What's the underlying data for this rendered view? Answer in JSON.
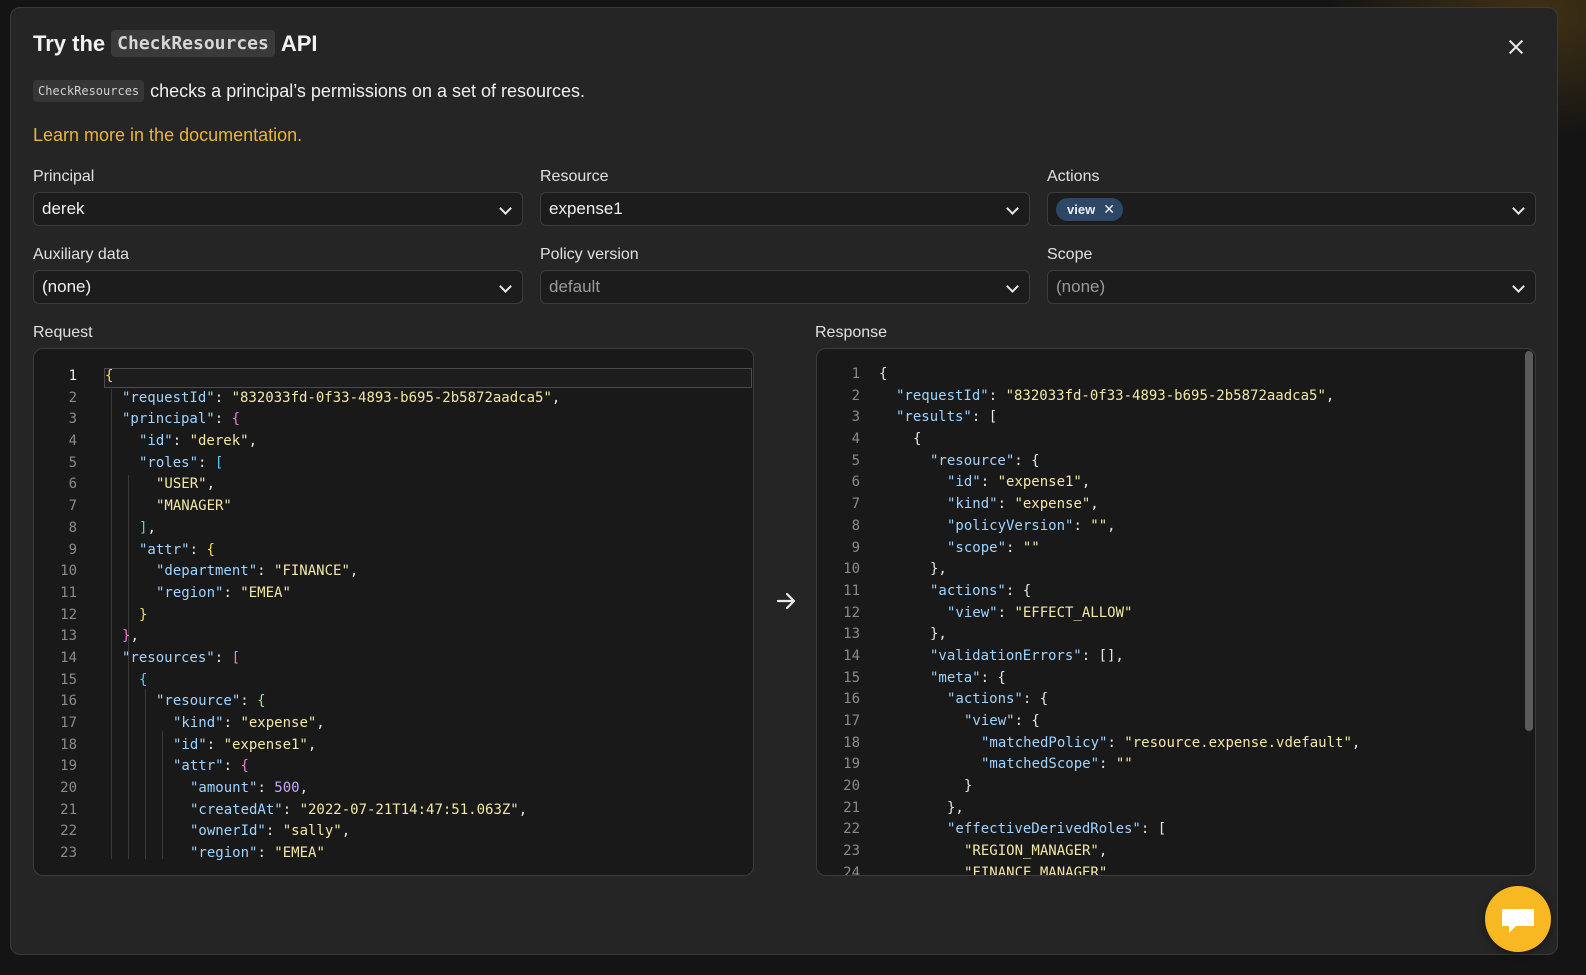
{
  "modal": {
    "title_prefix": "Try the",
    "title_code": "CheckResources",
    "title_suffix": "API",
    "desc_code": "CheckResources",
    "desc_text": "checks a principal’s permissions on a set of resources.",
    "doc_link": "Learn more in the documentation."
  },
  "fields": {
    "principal": {
      "label": "Principal",
      "value": "derek"
    },
    "resource": {
      "label": "Resource",
      "value": "expense1"
    },
    "actions": {
      "label": "Actions",
      "chips": [
        "view"
      ]
    },
    "auxiliary": {
      "label": "Auxiliary data",
      "value": "(none)"
    },
    "policy_version": {
      "label": "Policy version",
      "value": "default"
    },
    "scope": {
      "label": "Scope",
      "value": "(none)"
    }
  },
  "request": {
    "label": "Request",
    "lines": [
      [
        [
          "b1",
          "{"
        ]
      ],
      [
        [
          "k",
          "\"requestId\""
        ],
        [
          "p",
          ": "
        ],
        [
          "s",
          "\"832033fd-0f33-4893-b695-2b5872aadca5\""
        ],
        [
          "p",
          ","
        ]
      ],
      [
        [
          "k",
          "\"principal\""
        ],
        [
          "p",
          ": "
        ],
        [
          "b2",
          "{"
        ]
      ],
      [
        [
          "k",
          "\"id\""
        ],
        [
          "p",
          ": "
        ],
        [
          "s",
          "\"derek\""
        ],
        [
          "p",
          ","
        ]
      ],
      [
        [
          "k",
          "\"roles\""
        ],
        [
          "p",
          ": "
        ],
        [
          "b3",
          "["
        ]
      ],
      [
        [
          "s",
          "\"USER\""
        ],
        [
          "p",
          ","
        ]
      ],
      [
        [
          "s",
          "\"MANAGER\""
        ]
      ],
      [
        [
          "b3",
          "]"
        ],
        [
          "p",
          ","
        ]
      ],
      [
        [
          "k",
          "\"attr\""
        ],
        [
          "p",
          ": "
        ],
        [
          "b1",
          "{"
        ]
      ],
      [
        [
          "k",
          "\"department\""
        ],
        [
          "p",
          ": "
        ],
        [
          "s",
          "\"FINANCE\""
        ],
        [
          "p",
          ","
        ]
      ],
      [
        [
          "k",
          "\"region\""
        ],
        [
          "p",
          ": "
        ],
        [
          "s",
          "\"EMEA\""
        ]
      ],
      [
        [
          "b1",
          "}"
        ]
      ],
      [
        [
          "b2",
          "}"
        ],
        [
          "p",
          ","
        ]
      ],
      [
        [
          "k",
          "\"resources\""
        ],
        [
          "p",
          ": "
        ],
        [
          "b2",
          "["
        ]
      ],
      [
        [
          "b3",
          "{"
        ]
      ],
      [
        [
          "k",
          "\"resource\""
        ],
        [
          "p",
          ": "
        ],
        [
          "b4",
          "{"
        ]
      ],
      [
        [
          "k",
          "\"kind\""
        ],
        [
          "p",
          ": "
        ],
        [
          "s",
          "\"expense\""
        ],
        [
          "p",
          ","
        ]
      ],
      [
        [
          "k",
          "\"id\""
        ],
        [
          "p",
          ": "
        ],
        [
          "s",
          "\"expense1\""
        ],
        [
          "p",
          ","
        ]
      ],
      [
        [
          "k",
          "\"attr\""
        ],
        [
          "p",
          ": "
        ],
        [
          "b2",
          "{"
        ]
      ],
      [
        [
          "k",
          "\"amount\""
        ],
        [
          "p",
          ": "
        ],
        [
          "n",
          "500"
        ],
        [
          "p",
          ","
        ]
      ],
      [
        [
          "k",
          "\"createdAt\""
        ],
        [
          "p",
          ": "
        ],
        [
          "s",
          "\"2022-07-21T14:47:51.063Z\""
        ],
        [
          "p",
          ","
        ]
      ],
      [
        [
          "k",
          "\"ownerId\""
        ],
        [
          "p",
          ": "
        ],
        [
          "s",
          "\"sally\""
        ],
        [
          "p",
          ","
        ]
      ],
      [
        [
          "k",
          "\"region\""
        ],
        [
          "p",
          ": "
        ],
        [
          "s",
          "\"EMEA\""
        ]
      ]
    ]
  },
  "response": {
    "label": "Response",
    "lines": [
      [
        [
          "p",
          "{"
        ]
      ],
      [
        [
          "k",
          "\"requestId\""
        ],
        [
          "p",
          ": "
        ],
        [
          "s",
          "\"832033fd-0f33-4893-b695-2b5872aadca5\""
        ],
        [
          "p",
          ","
        ]
      ],
      [
        [
          "k",
          "\"results\""
        ],
        [
          "p",
          ": ["
        ]
      ],
      [
        [
          "p",
          "{"
        ]
      ],
      [
        [
          "k",
          "\"resource\""
        ],
        [
          "p",
          ": {"
        ]
      ],
      [
        [
          "k",
          "\"id\""
        ],
        [
          "p",
          ": "
        ],
        [
          "s",
          "\"expense1\""
        ],
        [
          "p",
          ","
        ]
      ],
      [
        [
          "k",
          "\"kind\""
        ],
        [
          "p",
          ": "
        ],
        [
          "s",
          "\"expense\""
        ],
        [
          "p",
          ","
        ]
      ],
      [
        [
          "k",
          "\"policyVersion\""
        ],
        [
          "p",
          ": "
        ],
        [
          "s",
          "\"\""
        ],
        [
          "p",
          ","
        ]
      ],
      [
        [
          "k",
          "\"scope\""
        ],
        [
          "p",
          ": "
        ],
        [
          "s",
          "\"\""
        ]
      ],
      [
        [
          "p",
          "},"
        ]
      ],
      [
        [
          "k",
          "\"actions\""
        ],
        [
          "p",
          ": {"
        ]
      ],
      [
        [
          "k",
          "\"view\""
        ],
        [
          "p",
          ": "
        ],
        [
          "s",
          "\"EFFECT_ALLOW\""
        ]
      ],
      [
        [
          "p",
          "},"
        ]
      ],
      [
        [
          "k",
          "\"validationErrors\""
        ],
        [
          "p",
          ": [],"
        ]
      ],
      [
        [
          "k",
          "\"meta\""
        ],
        [
          "p",
          ": {"
        ]
      ],
      [
        [
          "k",
          "\"actions\""
        ],
        [
          "p",
          ": {"
        ]
      ],
      [
        [
          "k",
          "\"view\""
        ],
        [
          "p",
          ": {"
        ]
      ],
      [
        [
          "k",
          "\"matchedPolicy\""
        ],
        [
          "p",
          ": "
        ],
        [
          "s",
          "\"resource.expense.vdefault\""
        ],
        [
          "p",
          ","
        ]
      ],
      [
        [
          "k",
          "\"matchedScope\""
        ],
        [
          "p",
          ": "
        ],
        [
          "s",
          "\"\""
        ]
      ],
      [
        [
          "p",
          "}"
        ]
      ],
      [
        [
          "p",
          "},"
        ]
      ],
      [
        [
          "k",
          "\"effectiveDerivedRoles\""
        ],
        [
          "p",
          ": ["
        ]
      ],
      [
        [
          "s",
          "\"REGION_MANAGER\""
        ],
        [
          "p",
          ","
        ]
      ],
      [
        [
          "s",
          "\"FINANCE_MANAGER\""
        ]
      ]
    ]
  }
}
